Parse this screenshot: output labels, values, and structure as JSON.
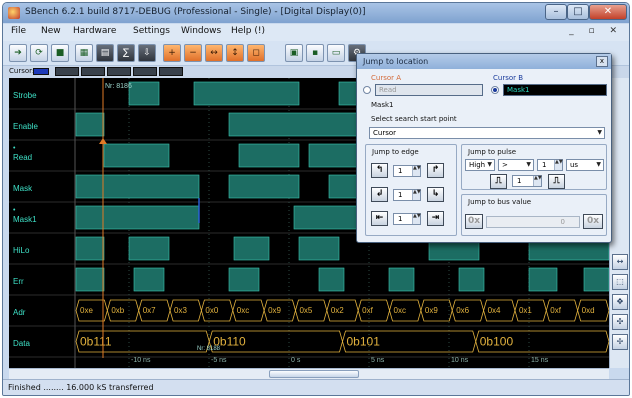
{
  "window": {
    "title": "SBench 6.2.1 build 8717-DEBUG (Professional - Single) - [Digital Display(0)]",
    "controls": {
      "minimize": "–",
      "maximize": "□",
      "close": "✕"
    }
  },
  "menu": {
    "items": [
      "File",
      "New",
      "Hardware",
      "Settings",
      "Windows",
      "Help (!)"
    ],
    "mdi_controls": "_ ▫ ✕"
  },
  "cursorbar": {
    "label": "Cursor:"
  },
  "signals": [
    {
      "name": "Strobe",
      "mark": ""
    },
    {
      "name": "Enable",
      "mark": ""
    },
    {
      "name": "Read",
      "mark": "•"
    },
    {
      "name": "Mask",
      "mark": ""
    },
    {
      "name": "Mask1",
      "mark": "•"
    },
    {
      "name": "HiLo",
      "mark": ""
    },
    {
      "name": "Err",
      "mark": ""
    },
    {
      "name": "Adr",
      "mark": ""
    },
    {
      "name": "Data",
      "mark": ""
    }
  ],
  "cursor_a_readout": "Nr: 8186",
  "cursor_b_readout": "Nr: 8188",
  "adr_values": [
    "0xe",
    "0xb",
    "0x7",
    "0x3",
    "0x0",
    "0xc",
    "0x9",
    "0x5",
    "0x2",
    "0xf",
    "0xc",
    "0x9",
    "0x6",
    "0x4",
    "0x1",
    "0xf",
    "0xd"
  ],
  "data_values": [
    "0b111",
    "0b110",
    "0b101",
    "0b100"
  ],
  "time_axis": [
    "-10 ns",
    "-5 ns",
    "0 s",
    "5 ns",
    "10 ns",
    "15 ns"
  ],
  "status": {
    "text": "Finished ........ 16.000 kS transferred"
  },
  "dialog": {
    "title": "Jump to location",
    "close": "x",
    "cursor_a": {
      "label": "Cursor A",
      "value": "Read"
    },
    "cursor_b": {
      "label": "Cursor B",
      "value": "Mask1"
    },
    "selected_signal": "Mask1",
    "search_start_label": "Select search start point",
    "search_start_value": "Cursor",
    "jump_edge": {
      "label": "Jump to edge",
      "counts": [
        "1",
        "1",
        "1"
      ]
    },
    "jump_pulse": {
      "label": "Jump to pulse",
      "level": "High",
      "compare": ">",
      "value": "1",
      "unit": "us",
      "count": "1"
    },
    "jump_bus": {
      "label": "Jump to bus value",
      "prefix": "0x",
      "value": "0",
      "go": "0x"
    }
  },
  "colors": {
    "wave_fill": "#1c6d63",
    "wave_edge": "#3bc6b3",
    "label_text": "#3ee0c6",
    "bus_text": "#e2b23e",
    "cursor_a": "#e07a26",
    "cursor_b": "#2b63e0"
  }
}
